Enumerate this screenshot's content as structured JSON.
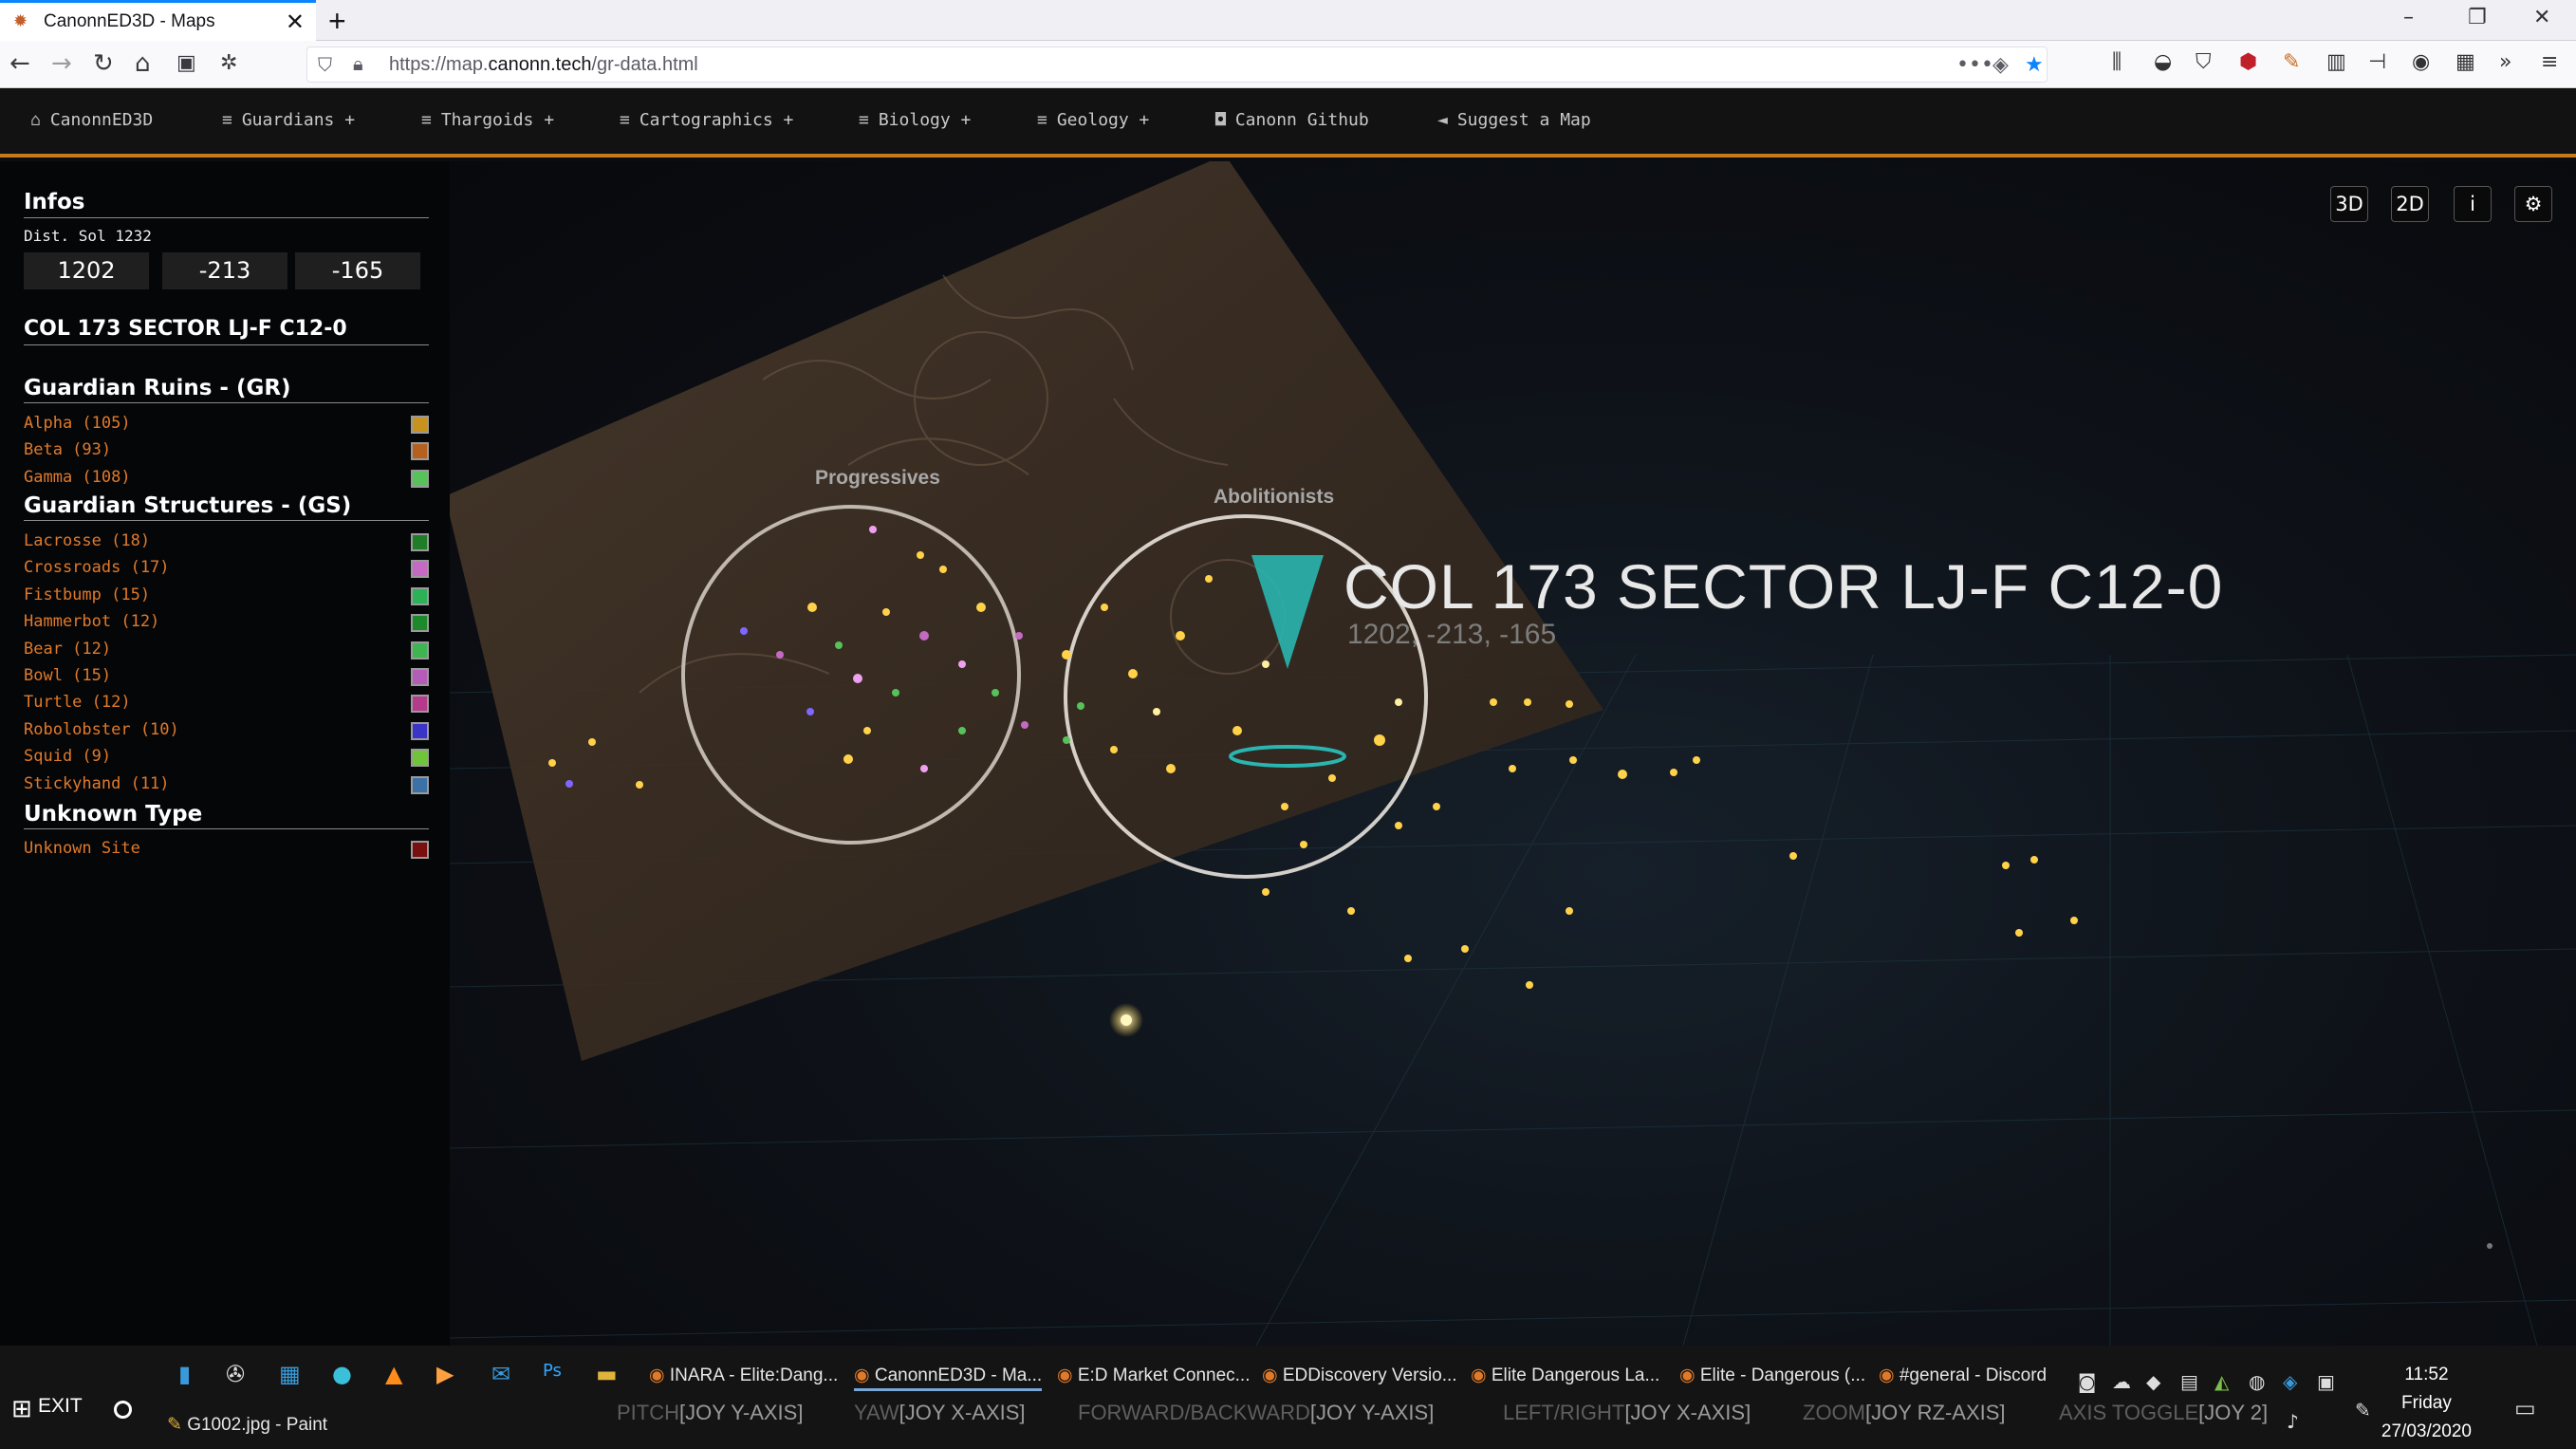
{
  "browser": {
    "tab_title": "CanonnED3D - Maps",
    "tab_close": "✕",
    "new_tab": "+",
    "url_prefix": "https://map.",
    "url_domain": "canonn.tech",
    "url_path": "/gr-data.html",
    "window_controls": [
      "–",
      "❐",
      "✕"
    ]
  },
  "appnav": {
    "items": [
      {
        "icon": "home-icon",
        "glyph": "⌂",
        "label": "CanonnED3D"
      },
      {
        "icon": "menu-icon",
        "glyph": "≡",
        "label": "Guardians +"
      },
      {
        "icon": "menu-icon",
        "glyph": "≡",
        "label": "Thargoids +"
      },
      {
        "icon": "menu-icon",
        "glyph": "≡",
        "label": "Cartographics +"
      },
      {
        "icon": "menu-icon",
        "glyph": "≡",
        "label": "Biology +"
      },
      {
        "icon": "menu-icon",
        "glyph": "≡",
        "label": "Geology +"
      },
      {
        "icon": "github-icon",
        "glyph": "◘",
        "label": "Canonn Github"
      },
      {
        "icon": "megaphone-icon",
        "glyph": "◄",
        "label": "Suggest a Map"
      }
    ]
  },
  "sidebar": {
    "infos_title": "Infos",
    "dist_label": "Dist. Sol 1232",
    "coords": [
      "1202",
      "-213",
      "-165"
    ],
    "system_name": "COL 173 SECTOR LJ-F C12-0",
    "groups": [
      {
        "title": "Guardian Ruins - (GR)",
        "items": [
          {
            "label": "Alpha (105)",
            "color": "#c8921e"
          },
          {
            "label": "Beta (93)",
            "color": "#b5601e"
          },
          {
            "label": "Gamma (108)",
            "color": "#58c25a"
          }
        ]
      },
      {
        "title": "Guardian Structures - (GS)",
        "items": [
          {
            "label": "Lacrosse (18)",
            "color": "#1f7d27"
          },
          {
            "label": "Crossroads (17)",
            "color": "#c46ac2"
          },
          {
            "label": "Fistbump (15)",
            "color": "#2bb257"
          },
          {
            "label": "Hammerbot (12)",
            "color": "#1c8a2a"
          },
          {
            "label": "Bear (12)",
            "color": "#3fb552"
          },
          {
            "label": "Bowl (15)",
            "color": "#b45db8"
          },
          {
            "label": "Turtle (12)",
            "color": "#b53a8c"
          },
          {
            "label": "Robolobster (10)",
            "color": "#3b35c7"
          },
          {
            "label": "Squid (9)",
            "color": "#6fc43a"
          },
          {
            "label": "Stickyhand (11)",
            "color": "#3c71a8"
          }
        ]
      },
      {
        "title": "Unknown Type",
        "items": [
          {
            "label": "Unknown Site",
            "color": "#7a0f0f"
          }
        ]
      }
    ]
  },
  "viewport": {
    "buttons": [
      "3D",
      "2D",
      "i",
      "⚙"
    ],
    "circle_labels": [
      "Progressives",
      "Abolitionists"
    ],
    "system_title": "COL 173 SECTOR LJ-F C12-0",
    "system_coords": "1202, -213, -165"
  },
  "taskbar": {
    "apps": [
      {
        "label": "INARA - Elite:Dang...",
        "active": false
      },
      {
        "label": "CanonnED3D - Ma...",
        "active": true
      },
      {
        "label": "E:D Market Connec...",
        "active": false
      },
      {
        "label": "EDDiscovery Versio...",
        "active": false
      },
      {
        "label": "Elite Dangerous La...",
        "active": false
      },
      {
        "label": "Elite - Dangerous (...",
        "active": false
      },
      {
        "label": "#general - Discord",
        "active": false
      }
    ],
    "paint_label": "G1002.jpg - Paint",
    "exit_label": "EXIT",
    "hud": [
      {
        "key": "PITCH",
        "val": "[JOY Y-AXIS]"
      },
      {
        "key": "YAW",
        "val": "[JOY X-AXIS]"
      },
      {
        "key": "FORWARD/BACKWARD",
        "val": "[JOY Y-AXIS]"
      },
      {
        "key": "LEFT/RIGHT",
        "val": "[JOY X-AXIS]"
      },
      {
        "key": "ZOOM",
        "val": "[JOY RZ-AXIS]"
      },
      {
        "key": "AXIS TOGGLE",
        "val": "[JOY 2]"
      }
    ],
    "time": "11:52",
    "day": "Friday",
    "date": "27/03/2020"
  }
}
